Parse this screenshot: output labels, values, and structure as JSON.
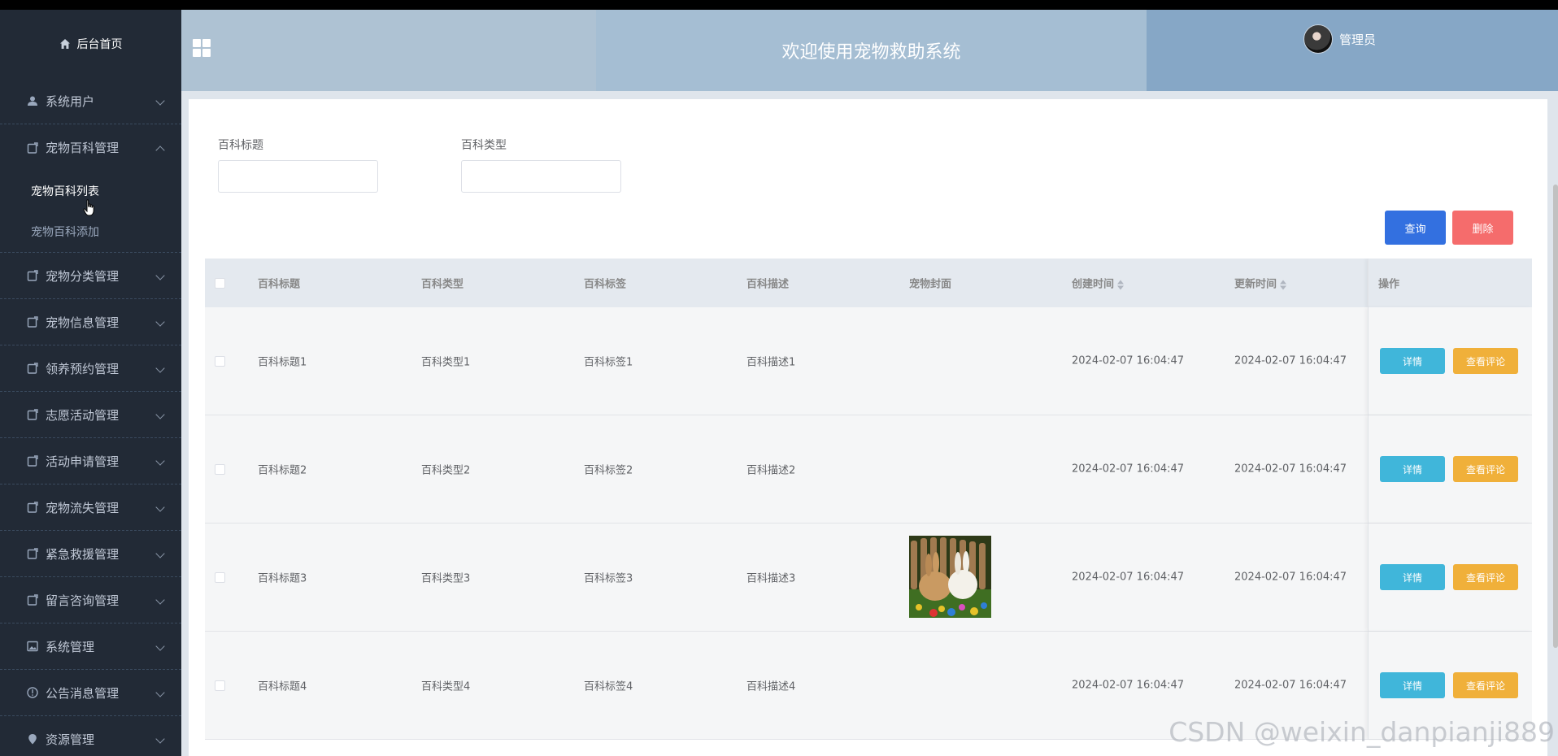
{
  "sidebar": {
    "home": "后台首页",
    "items": [
      {
        "label": "系统用户",
        "icon": "user-icon"
      },
      {
        "label": "宠物百科管理",
        "icon": "document-icon",
        "open": true,
        "children": [
          "宠物百科列表",
          "宠物百科添加"
        ]
      },
      {
        "label": "宠物分类管理",
        "icon": "document-icon"
      },
      {
        "label": "宠物信息管理",
        "icon": "document-icon"
      },
      {
        "label": "领养预约管理",
        "icon": "document-icon"
      },
      {
        "label": "志愿活动管理",
        "icon": "document-icon"
      },
      {
        "label": "活动申请管理",
        "icon": "document-icon"
      },
      {
        "label": "宠物流失管理",
        "icon": "document-icon"
      },
      {
        "label": "紧急救援管理",
        "icon": "document-icon"
      },
      {
        "label": "留言咨询管理",
        "icon": "document-icon"
      },
      {
        "label": "系统管理",
        "icon": "image-icon"
      },
      {
        "label": "公告消息管理",
        "icon": "info-icon"
      },
      {
        "label": "资源管理",
        "icon": "location-icon"
      }
    ]
  },
  "header": {
    "title": "欢迎使用宠物救助系统",
    "user": "管理员"
  },
  "search": {
    "title_label": "百科标题",
    "type_label": "百科类型",
    "query_button": "查询",
    "delete_button": "删除"
  },
  "table": {
    "columns": [
      "百科标题",
      "百科类型",
      "百科标签",
      "百科描述",
      "宠物封面",
      "创建时间",
      "更新时间",
      "操作"
    ],
    "rows": [
      {
        "title": "百科标题1",
        "type": "百科类型1",
        "tag": "百科标签1",
        "desc": "百科描述1",
        "created": "2024-02-07 16:04:47",
        "updated": "2024-02-07 16:04:47"
      },
      {
        "title": "百科标题2",
        "type": "百科类型2",
        "tag": "百科标签2",
        "desc": "百科描述2",
        "created": "2024-02-07 16:04:47",
        "updated": "2024-02-07 16:04:47"
      },
      {
        "title": "百科标题3",
        "type": "百科类型3",
        "tag": "百科标签3",
        "desc": "百科描述3",
        "created": "2024-02-07 16:04:47",
        "updated": "2024-02-07 16:04:47",
        "has_image": true
      },
      {
        "title": "百科标题4",
        "type": "百科类型4",
        "tag": "百科标签4",
        "desc": "百科描述4",
        "created": "2024-02-07 16:04:47",
        "updated": "2024-02-07 16:04:47"
      }
    ],
    "detail_button": "详情",
    "comment_button": "查看评论"
  },
  "watermark": "CSDN @weixin_danpianji889",
  "colors": {
    "sidebar_bg": "#222a36",
    "query_btn": "#3370e0",
    "delete_btn": "#f56c6c",
    "detail_btn": "#40b6da",
    "comment_btn": "#f0b03a"
  }
}
